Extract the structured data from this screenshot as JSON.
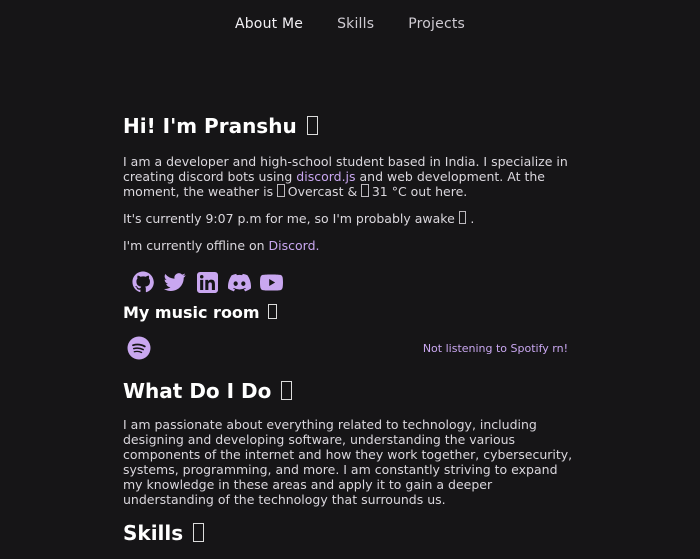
{
  "nav": {
    "items": [
      {
        "label": "About Me"
      },
      {
        "label": "Skills"
      },
      {
        "label": "Projects"
      }
    ]
  },
  "intro": {
    "title": "Hi! I'm Pranshu",
    "p1_a": "I am a developer and high-school student based in India. I specialize in creating discord bots using ",
    "p1_link": "discord.js",
    "p1_b": " and web development. At the moment, the weather is ",
    "weather_text": "Overcast &",
    "temp_text": "31 °C out here.",
    "p2": "It's currently 9:07 p.m for me, so I'm probably awake",
    "p2_end": ".",
    "p3_a": "I'm currently offline on ",
    "p3_link": "Discord."
  },
  "socials": [
    {
      "icon": "github-icon"
    },
    {
      "icon": "twitter-icon"
    },
    {
      "icon": "linkedin-icon"
    },
    {
      "icon": "discord-icon"
    },
    {
      "icon": "youtube-icon"
    }
  ],
  "music": {
    "title": "My music room",
    "status": "Not listening to Spotify rn!"
  },
  "what": {
    "title": "What Do I Do",
    "text": "I am passionate about everything related to technology, including designing and developing software, understanding the various components of the internet and how they work together, cybersecurity, systems, programming, and more. I am constantly striving to expand my knowledge in these areas and apply it to gain a deeper understanding of the technology that surrounds us."
  },
  "skills": {
    "title": "Skills"
  },
  "colors": {
    "background": "#161517",
    "accent": "#c9a7f0",
    "text": "#dad7dd"
  }
}
